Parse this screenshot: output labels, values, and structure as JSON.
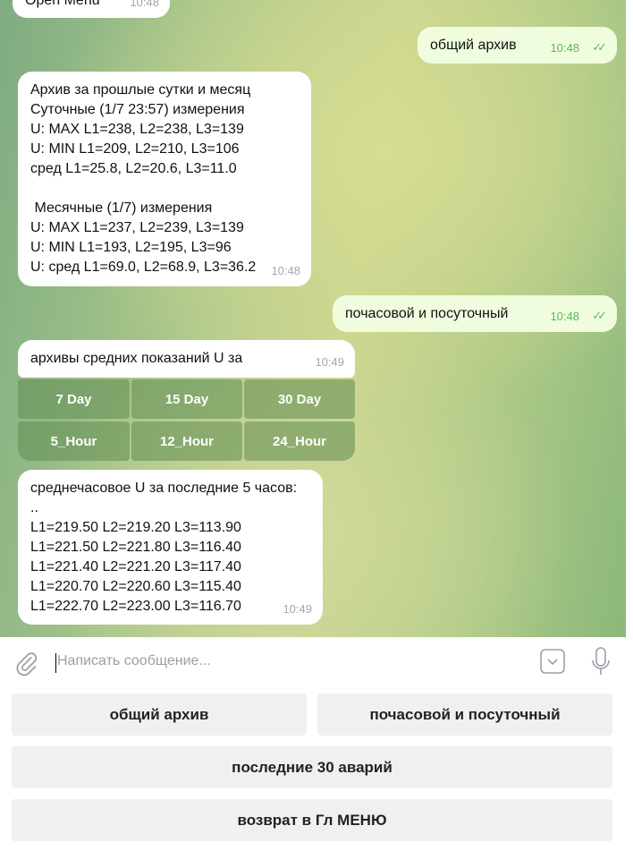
{
  "messages": [
    {
      "type": "in",
      "lines": [
        "Open Menu"
      ],
      "time": "10:48"
    },
    {
      "type": "out",
      "lines": [
        "общий архив"
      ],
      "time": "10:48"
    },
    {
      "type": "in",
      "lines": [
        "Архив за прошлые сутки и месяц",
        "Суточные (1/7 23:57) измерения",
        "U: MAX L1=238, L2=238, L3=139",
        "U: MIN L1=209, L2=210, L3=106",
        "сред L1=25.8, L2=20.6, L3=11.0",
        "",
        " Месячные (1/7) измерения",
        "U: MAX L1=237, L2=239, L3=139",
        "U: MIN L1=193, L2=195, L3=96",
        "U: сред L1=69.0, L2=68.9, L3=36.2"
      ],
      "time": "10:48"
    },
    {
      "type": "out",
      "lines": [
        "почасовой и посуточный"
      ],
      "time": "10:48"
    },
    {
      "type": "in",
      "lines": [
        "архивы средних показаний U за"
      ],
      "time": "10:49"
    },
    {
      "type": "in",
      "lines": [
        "среднечасовое U за последние 5 часов:",
        "..",
        "L1=219.50 L2=219.20 L3=113.90",
        "L1=221.50 L2=221.80 L3=116.40",
        "L1=221.40 L2=221.20 L3=117.40",
        "L1=220.70 L2=220.60 L3=115.40",
        "L1=222.70 L2=223.00 L3=116.70"
      ],
      "time": "10:49"
    }
  ],
  "inline_keyboard": [
    "7 Day",
    "15 Day",
    "30 Day",
    "5_Hour",
    "12_Hour",
    "24_Hour"
  ],
  "input": {
    "placeholder": "Написать сообщение...",
    "value": ""
  },
  "icons": {
    "attach": "paperclip-icon",
    "keyboard": "keyboard-toggle-icon",
    "mic": "microphone-icon",
    "read": "double-check-icon"
  },
  "reply_keyboard": [
    "общий архив",
    "почасовой и посуточный",
    "последние 30 аварий",
    "возврат в Гл МЕНЮ"
  ],
  "colors": {
    "outgoing_bubble": "#effdde",
    "incoming_bubble": "#ffffff",
    "check": "#5fb65b"
  }
}
